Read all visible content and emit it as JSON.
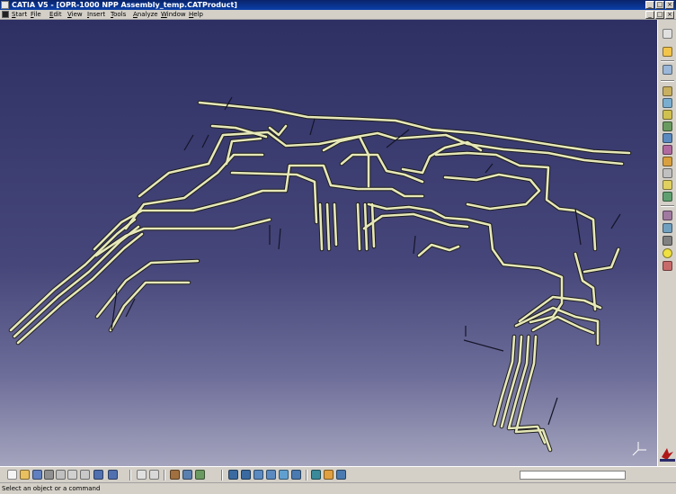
{
  "window": {
    "title": "CATIA V5 - [OPR-1000 NPP Assembly_temp.CATProduct]"
  },
  "menu": {
    "items": [
      {
        "label": "Start"
      },
      {
        "label": "File"
      },
      {
        "label": "Edit"
      },
      {
        "label": "View"
      },
      {
        "label": "Insert"
      },
      {
        "label": "Tools"
      },
      {
        "label": "Analyze"
      },
      {
        "label": "Window"
      },
      {
        "label": "Help"
      }
    ]
  },
  "status": {
    "text": "Select an object or a command"
  },
  "colors": {
    "accent_title": "#0a246a",
    "viewport_top": "#2e3064",
    "viewport_bottom": "#a4a4be",
    "pipe_fill": "#e6e8b8",
    "pipe_outline": "#1e1e1e"
  },
  "icons": {
    "right_toolbar": [
      "select-icon",
      "sketch-icon",
      "product-icon",
      "assembly-icon",
      "component-icon",
      "part-icon",
      "constraint-icon",
      "move-icon",
      "explode-icon",
      "snap-icon",
      "manipulate-icon",
      "clash-icon",
      "section-icon",
      "scenes-icon",
      "measure-icon",
      "lightbulb-icon",
      "tools-icon"
    ],
    "bottom_toolbar": [
      "new-icon",
      "open-icon",
      "save-icon",
      "print-icon",
      "cut-icon",
      "copy-icon",
      "paste-icon",
      "undo-icon",
      "redo-icon",
      "fx-icon",
      "what-is-this-icon",
      "catalog-icon",
      "fly-icon",
      "fit-all-icon",
      "pan-icon",
      "rotate-icon",
      "zoom-in-icon",
      "zoom-out-icon",
      "normal-view-icon",
      "iso-view-icon",
      "shading-icon",
      "hide-show-icon",
      "swap-visible-icon"
    ]
  }
}
